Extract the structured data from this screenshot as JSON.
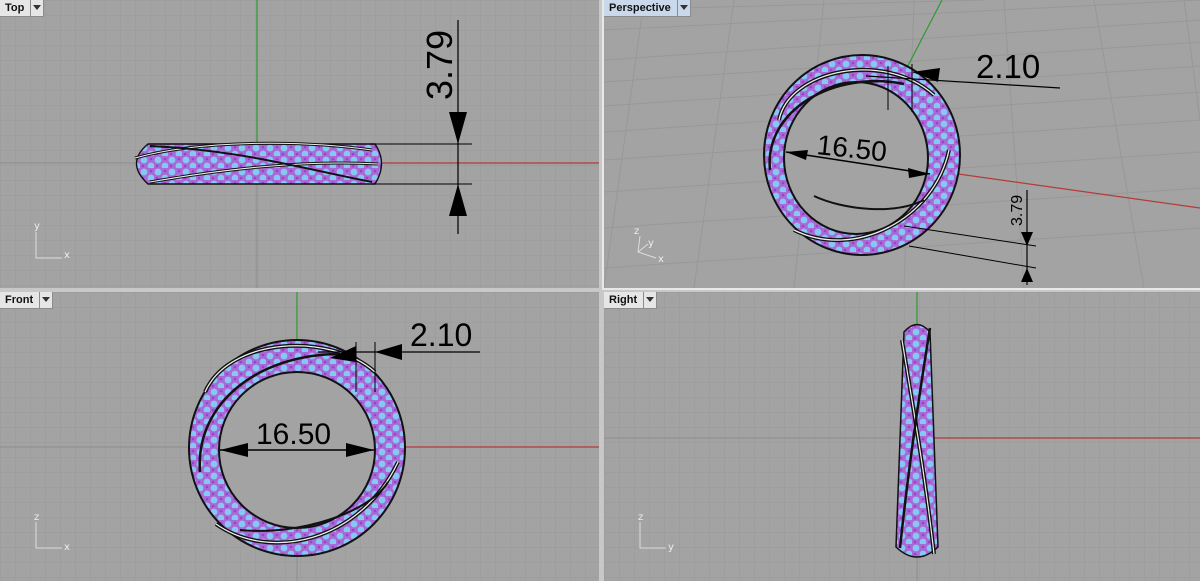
{
  "viewports": {
    "top": {
      "label": "Top",
      "axes": {
        "vertical": "y",
        "horizontal": "x"
      },
      "dims": {
        "width_value": "3.79"
      }
    },
    "perspective": {
      "label": "Perspective",
      "axes": {
        "vertical": "z",
        "horizontal": "y",
        "depth": "x"
      },
      "dims": {
        "band_value": "2.10",
        "diameter_value": "16.50",
        "width_value": "3.79"
      }
    },
    "front": {
      "label": "Front",
      "axes": {
        "vertical": "z",
        "horizontal": "x"
      },
      "dims": {
        "band_value": "2.10",
        "diameter_value": "16.50"
      }
    },
    "right": {
      "label": "Right",
      "axes": {
        "vertical": "z",
        "horizontal": "y"
      }
    }
  },
  "colors": {
    "grid_bg": "#a3a3a3",
    "grid_minor": "#9a9a9a",
    "grid_major": "#8f8f8f",
    "x_axis": "#b53a3a",
    "y_axis": "#2f9a2f",
    "gem_blue": "#86c7f3",
    "gem_purple": "#9b3fcf",
    "metal_outline": "#111111"
  },
  "icons": {
    "dropdown": "chevron-down-icon"
  }
}
